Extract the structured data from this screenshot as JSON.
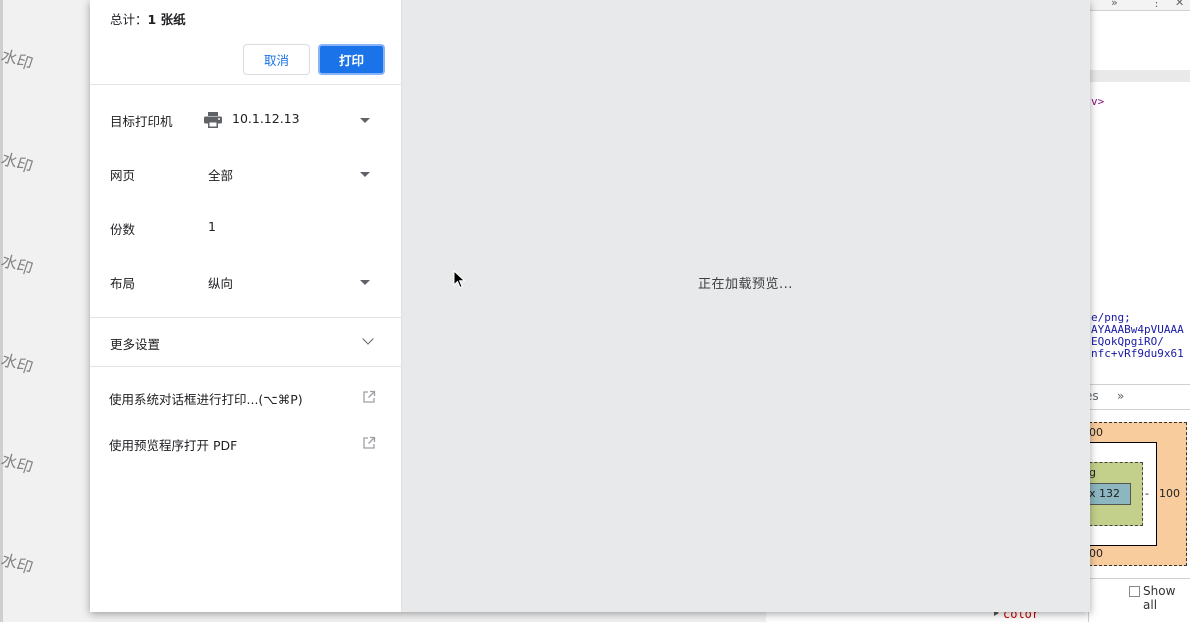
{
  "watermark": {
    "text": "水印"
  },
  "dialog": {
    "total_label": "总计：",
    "total_value": "1 张纸",
    "cancel_label": "取消",
    "print_label": "打印",
    "printer": {
      "label": "目标打印机",
      "value": "10.1.12.13",
      "icon": "printer-icon"
    },
    "pages": {
      "label": "网页",
      "value": "全部"
    },
    "copies": {
      "label": "份数",
      "value": "1"
    },
    "layout": {
      "label": "布局",
      "value": "纵向"
    },
    "more_settings": {
      "label": "更多设置",
      "icon": "chevron-down-icon"
    },
    "system_dialog": {
      "label": "使用系统对话框进行打印...(⌥⌘P)",
      "icon": "open-in-new-icon"
    },
    "open_pdf": {
      "label": "使用预览程序打开 PDF",
      "icon": "open-in-new-icon"
    },
    "preview_text": "正在加载预览...",
    "accent_color": "#1a73e8"
  },
  "devtools": {
    "top_glyphs": [
      "»",
      "⋮",
      "✕"
    ],
    "code_purple": "v>",
    "code_lines": [
      "e/png;",
      "AYAAABw4pVUAAA",
      "EQokQpgiRO/",
      "nfc+vRf9du9x61"
    ],
    "tab_partial": "es",
    "tab_more": "»",
    "box_margin_top": "00",
    "box_margin_bottom": "00",
    "box_padding_label": "g",
    "box_content_size": "x 132",
    "box_right_dash": "-",
    "box_right_value": "100",
    "show_all_label": "Show all",
    "style_prop": "color"
  }
}
